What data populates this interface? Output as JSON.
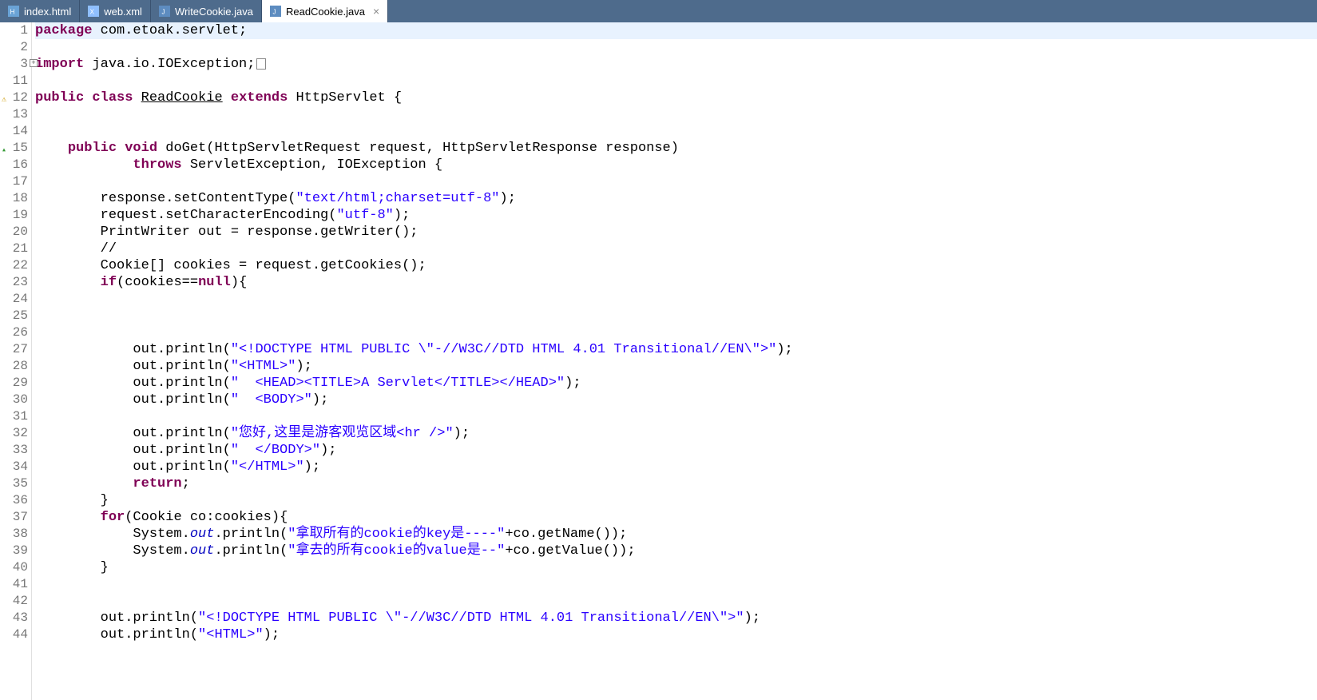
{
  "tabs": [
    {
      "label": "index.html",
      "icon": "html-file-icon",
      "active": false
    },
    {
      "label": "web.xml",
      "icon": "xml-file-icon",
      "active": false
    },
    {
      "label": "WriteCookie.java",
      "icon": "java-file-icon",
      "active": false
    },
    {
      "label": "ReadCookie.java",
      "icon": "java-file-icon",
      "active": true
    }
  ],
  "gutter": {
    "lines": [
      "1",
      "2",
      "3",
      "11",
      "12",
      "13",
      "14",
      "15",
      "16",
      "17",
      "18",
      "19",
      "20",
      "21",
      "22",
      "23",
      "24",
      "25",
      "26",
      "27",
      "28",
      "29",
      "30",
      "31",
      "32",
      "33",
      "34",
      "35",
      "36",
      "37",
      "38",
      "39",
      "40",
      "41",
      "42",
      "43",
      "44"
    ],
    "markers": {
      "3": "plus",
      "12": "warning",
      "15": "triangle"
    }
  },
  "code": {
    "line1": {
      "kw1": "package",
      "pkg": " com.etoak.servlet;"
    },
    "line3": {
      "kw1": "import",
      "rest": " java.io.IOException;"
    },
    "line12": {
      "kw1": "public",
      "kw2": "class",
      "cls": "ReadCookie",
      "kw3": "extends",
      "sup": "HttpServlet {"
    },
    "line15": {
      "kw1": "public",
      "kw2": "void",
      "sig": "doGet(HttpServletRequest request, HttpServletResponse response)"
    },
    "line16": {
      "kw1": "throws",
      "rest": " ServletException, IOException {"
    },
    "line18": {
      "pre": "response.setContentType(",
      "str": "\"text/html;charset=utf-8\"",
      "post": ");"
    },
    "line19": {
      "pre": "request.setCharacterEncoding(",
      "str": "\"utf-8\"",
      "post": ");"
    },
    "line20": {
      "txt": "PrintWriter out = response.getWriter();"
    },
    "line21": {
      "txt": "//"
    },
    "line22": {
      "txt": "Cookie[] cookies = request.getCookies();"
    },
    "line23": {
      "kw": "if",
      "pre": "(cookies==",
      "kw2": "null",
      "post": "){"
    },
    "line27": {
      "pre": "out.println(",
      "str": "\"<!DOCTYPE HTML PUBLIC \\\"-//W3C//DTD HTML 4.01 Transitional//EN\\\">\"",
      "post": ");"
    },
    "line28": {
      "pre": "out.println(",
      "str": "\"<HTML>\"",
      "post": ");"
    },
    "line29": {
      "pre": "out.println(",
      "str": "\"  <HEAD><TITLE>A Servlet</TITLE></HEAD>\"",
      "post": ");"
    },
    "line30": {
      "pre": "out.println(",
      "str": "\"  <BODY>\"",
      "post": ");"
    },
    "line32": {
      "pre": "out.println(",
      "str": "\"您好,这里是游客观览区域<hr />\"",
      "post": ");"
    },
    "line33": {
      "pre": "out.println(",
      "str": "\"  </BODY>\"",
      "post": ");"
    },
    "line34": {
      "pre": "out.println(",
      "str": "\"</HTML>\"",
      "post": ");"
    },
    "line35": {
      "kw": "return",
      "post": ";"
    },
    "line36": {
      "txt": "}"
    },
    "line37": {
      "kw": "for",
      "rest": "(Cookie co:cookies){"
    },
    "line38": {
      "pre": "System.",
      "fld": "out",
      "mid": ".println(",
      "str": "\"拿取所有的cookie的key是----\"",
      "post": "+co.getName());"
    },
    "line39": {
      "pre": "System.",
      "fld": "out",
      "mid": ".println(",
      "str": "\"拿去的所有cookie的value是--\"",
      "post": "+co.getValue());"
    },
    "line40": {
      "txt": "}"
    },
    "line43": {
      "pre": "out.println(",
      "str": "\"<!DOCTYPE HTML PUBLIC \\\"-//W3C//DTD HTML 4.01 Transitional//EN\\\">\"",
      "post": ");"
    },
    "line44": {
      "pre": "out.println(",
      "str": "\"<HTML>\"",
      "post": ");"
    }
  }
}
